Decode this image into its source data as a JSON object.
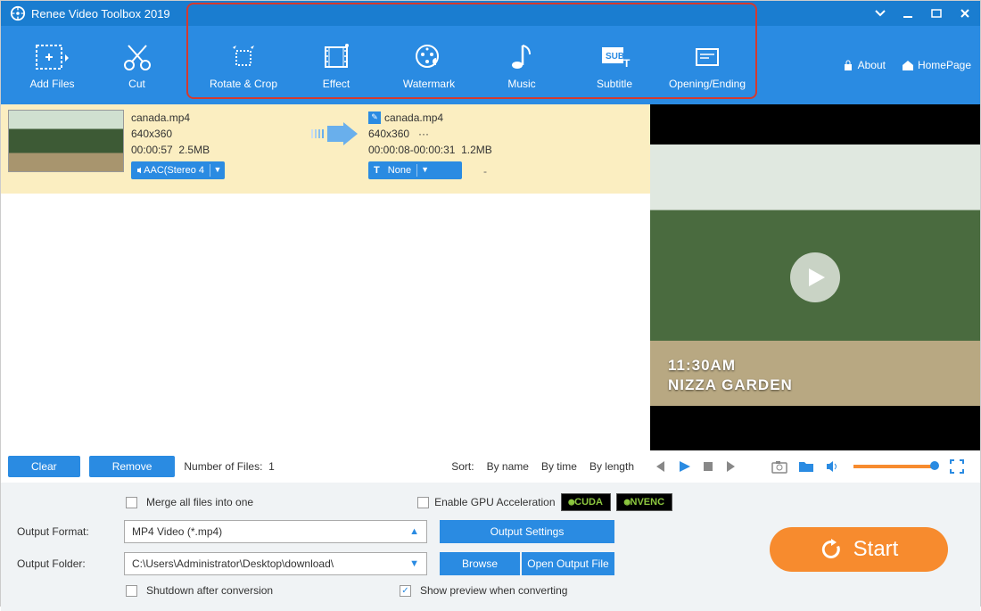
{
  "title": "Renee Video Toolbox 2019",
  "toolbar": {
    "add_files": "Add Files",
    "cut": "Cut",
    "rotate_crop": "Rotate & Crop",
    "effect": "Effect",
    "watermark": "Watermark",
    "music": "Music",
    "subtitle": "Subtitle",
    "opening_ending": "Opening/Ending",
    "about": "About",
    "homepage": "HomePage"
  },
  "file": {
    "src_name": "canada.mp4",
    "src_res": "640x360",
    "src_dur": "00:00:57",
    "src_size": "2.5MB",
    "dst_name": "canada.mp4",
    "dst_res": "640x360",
    "dst_range": "00:00:08-00:00:31",
    "dst_size": "1.2MB",
    "audio_label": "AAC(Stereo 4",
    "text_label": "None",
    "dash": "-"
  },
  "preview": {
    "overlay_time": "11:30AM",
    "overlay_place": "NIZZA GARDEN"
  },
  "controls": {
    "clear": "Clear",
    "remove": "Remove",
    "files_count_label": "Number of Files:",
    "files_count": "1",
    "sort_label": "Sort:",
    "sort_name": "By name",
    "sort_time": "By time",
    "sort_length": "By length"
  },
  "bottom": {
    "merge": "Merge all files into one",
    "gpu": "Enable GPU Acceleration",
    "cuda": "CUDA",
    "nvenc": "NVENC",
    "format_label": "Output Format:",
    "format_value": "MP4 Video (*.mp4)",
    "output_settings": "Output Settings",
    "folder_label": "Output Folder:",
    "folder_value": "C:\\Users\\Administrator\\Desktop\\download\\",
    "browse": "Browse",
    "open_folder": "Open Output File",
    "shutdown": "Shutdown after conversion",
    "preview": "Show preview when converting",
    "start": "Start"
  }
}
